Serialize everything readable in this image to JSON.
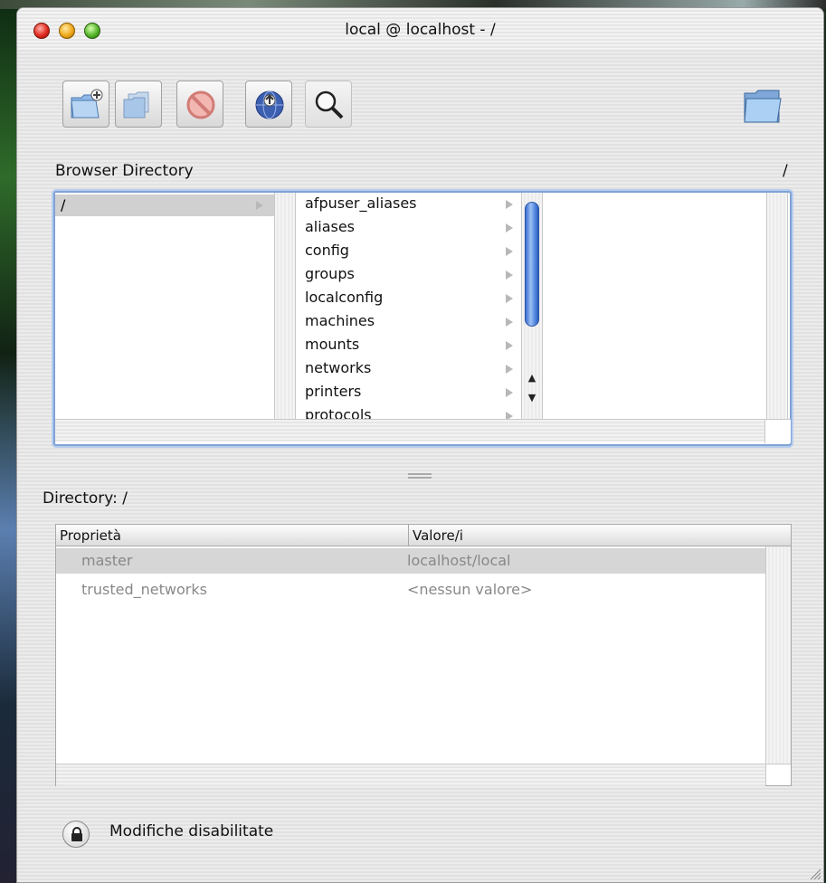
{
  "window": {
    "title": "local @ localhost - /"
  },
  "toolbar": {
    "buttons": [
      {
        "icon": "new-folder-icon"
      },
      {
        "icon": "duplicate-folder-icon"
      },
      {
        "icon": "delete-icon"
      },
      {
        "icon": "network-globe-icon"
      },
      {
        "icon": "search-magnifier-icon"
      }
    ],
    "right_icon": "folder-icon"
  },
  "browser": {
    "label": "Browser Directory",
    "path": "/",
    "column1": [
      {
        "label": "/",
        "selected": true
      }
    ],
    "column2": [
      {
        "label": "afpuser_aliases"
      },
      {
        "label": "aliases"
      },
      {
        "label": "config"
      },
      {
        "label": "groups"
      },
      {
        "label": "localconfig"
      },
      {
        "label": "machines"
      },
      {
        "label": "mounts"
      },
      {
        "label": "networks"
      },
      {
        "label": "printers"
      },
      {
        "label": "protocols"
      }
    ]
  },
  "directory": {
    "label": "Directory: /"
  },
  "properties": {
    "headers": [
      "Proprietà",
      "Valore/i"
    ],
    "rows": [
      {
        "key": "master",
        "value": "localhost/local",
        "selected": true
      },
      {
        "key": "trusted_networks",
        "value": "<nessun valore>",
        "selected": false
      }
    ]
  },
  "footer": {
    "lock_text": "Modifiche disabilitate"
  },
  "colors": {
    "accent": "#7fa2d6",
    "scroll_thumb": "#3a6ed0"
  }
}
